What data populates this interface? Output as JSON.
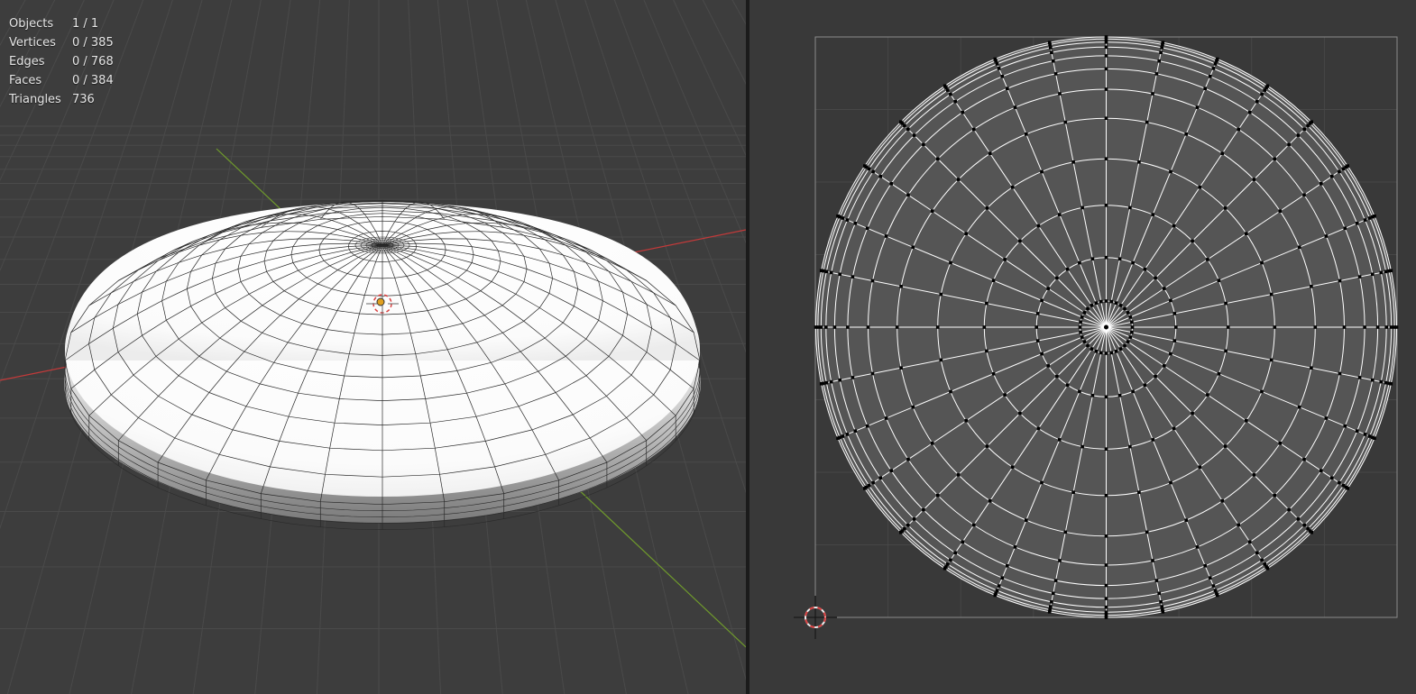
{
  "stats": {
    "objects": {
      "label": "Objects",
      "value": "1 / 1"
    },
    "vertices": {
      "label": "Vertices",
      "value": "0 / 385"
    },
    "edges": {
      "label": "Edges",
      "value": "0 / 768"
    },
    "faces": {
      "label": "Faces",
      "value": "0 / 384"
    },
    "triangles": {
      "label": "Triangles",
      "value": "736"
    }
  },
  "mesh": {
    "segments": 32,
    "rings": 12
  },
  "colors": {
    "viewport_bg": "#3d3d3d",
    "uv_bg": "#393939",
    "grid_line": "#4a4a4a",
    "axis_x": "#c33a3a",
    "axis_y": "#6f9a2c",
    "mesh_fill": "#ffffff",
    "uv_face": "#555555",
    "uv_edge": "#ffffff",
    "uv_vertex": "#000000",
    "cursor_ring": "#d94040"
  },
  "icons": {
    "cursor_3d": "3d-cursor-icon",
    "cursor_2d": "2d-cursor-icon",
    "origin": "object-origin-icon"
  }
}
